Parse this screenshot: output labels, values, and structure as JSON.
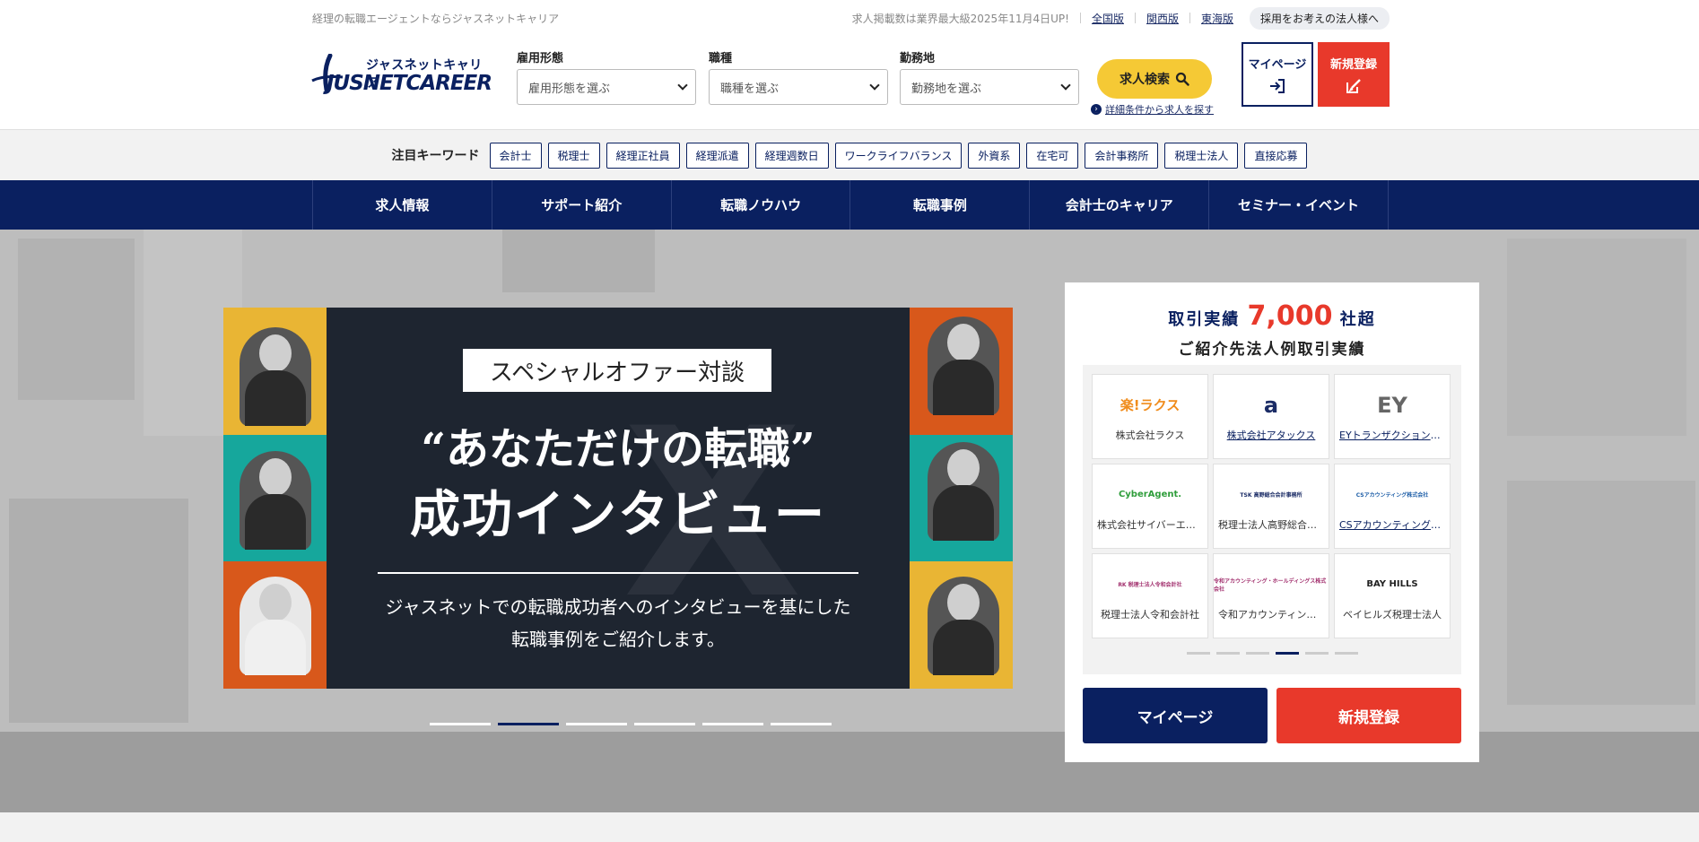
{
  "header": {
    "tagline": "経理の転職エージェントならジャスネットキャリア",
    "notice": "求人掲載数は業界最大級2025年11月4日UP!",
    "regions": [
      "全国版",
      "関西版",
      "東海版"
    ],
    "corp_button": "採用をお考えの法人様へ",
    "logo_jp": "ジャスネットキャリア",
    "logo_en": "JUSNETCAREER",
    "filters": [
      {
        "label": "雇用形態",
        "placeholder": "雇用形態を選ぶ"
      },
      {
        "label": "職種",
        "placeholder": "職種を選ぶ"
      },
      {
        "label": "勤務地",
        "placeholder": "勤務地を選ぶ"
      }
    ],
    "search_button": "求人検索",
    "detail_link": "詳細条件から求人を探す",
    "mypage": "マイページ",
    "register": "新規登録"
  },
  "keywords": {
    "title": "注目キーワード",
    "items": [
      "会計士",
      "税理士",
      "経理正社員",
      "経理派遣",
      "経理週数日",
      "ワークライフバランス",
      "外資系",
      "在宅可",
      "会計事務所",
      "税理士法人",
      "直接応募"
    ]
  },
  "nav": [
    "求人情報",
    "サポート紹介",
    "転職ノウハウ",
    "転職事例",
    "会計士のキャリア",
    "セミナー・イベント"
  ],
  "hero": {
    "tag": "スペシャルオファー対談",
    "headline1": "“あなただけの転職”",
    "headline2": "成功インタビュー",
    "desc1": "ジャスネットでの転職成功者へのインタビューを基にした",
    "desc2": "転職事例をご紹介します。",
    "active_slide": 1,
    "slide_count": 6
  },
  "card": {
    "title_prefix": "取引実績",
    "title_number": "7,000",
    "title_suffix": "社超",
    "subtitle": "ご紹介先法人例取引実績",
    "companies": [
      {
        "logo": "楽!ラクス",
        "name": "株式会社ラクス",
        "link": false,
        "color": "#f08c1c"
      },
      {
        "logo": "a",
        "name": "株式会社アタックス",
        "link": true,
        "color": "#1b2c66"
      },
      {
        "logo": "EY",
        "name": "EYトランザクション・アドバイザリー・サービス株式会社",
        "link": true,
        "color": "#666666"
      },
      {
        "logo": "CyberAgent.",
        "name": "株式会社サイバーエージェント",
        "link": false,
        "color": "#2e9d3a"
      },
      {
        "logo": "TSK 高野総合会計事務所",
        "name": "税理士法人高野総合会計事務所",
        "link": false,
        "color": "#1b2c66"
      },
      {
        "logo": "CSアカウンティング株式会社",
        "name": "CSアカウンティング株式会社",
        "link": true,
        "color": "#1f5fa8"
      },
      {
        "logo": "RK 税理士法人令和会計社",
        "name": "税理士法人令和会計社",
        "link": false,
        "color": "#a2306e"
      },
      {
        "logo": "令和アカウンティング・ホールディングス株式会社",
        "name": "令和アカウンティング・ホールディングス株式会社",
        "link": false,
        "color": "#a2306e"
      },
      {
        "logo": "BAY HILLS",
        "name": "ベイヒルズ税理士法人",
        "link": false,
        "color": "#222222"
      }
    ],
    "active_page": 3,
    "page_count": 6,
    "mypage": "マイページ",
    "register": "新規登録"
  },
  "colors": {
    "navy": "#0a2060",
    "red": "#e8392b",
    "yellow": "#f5c935"
  }
}
